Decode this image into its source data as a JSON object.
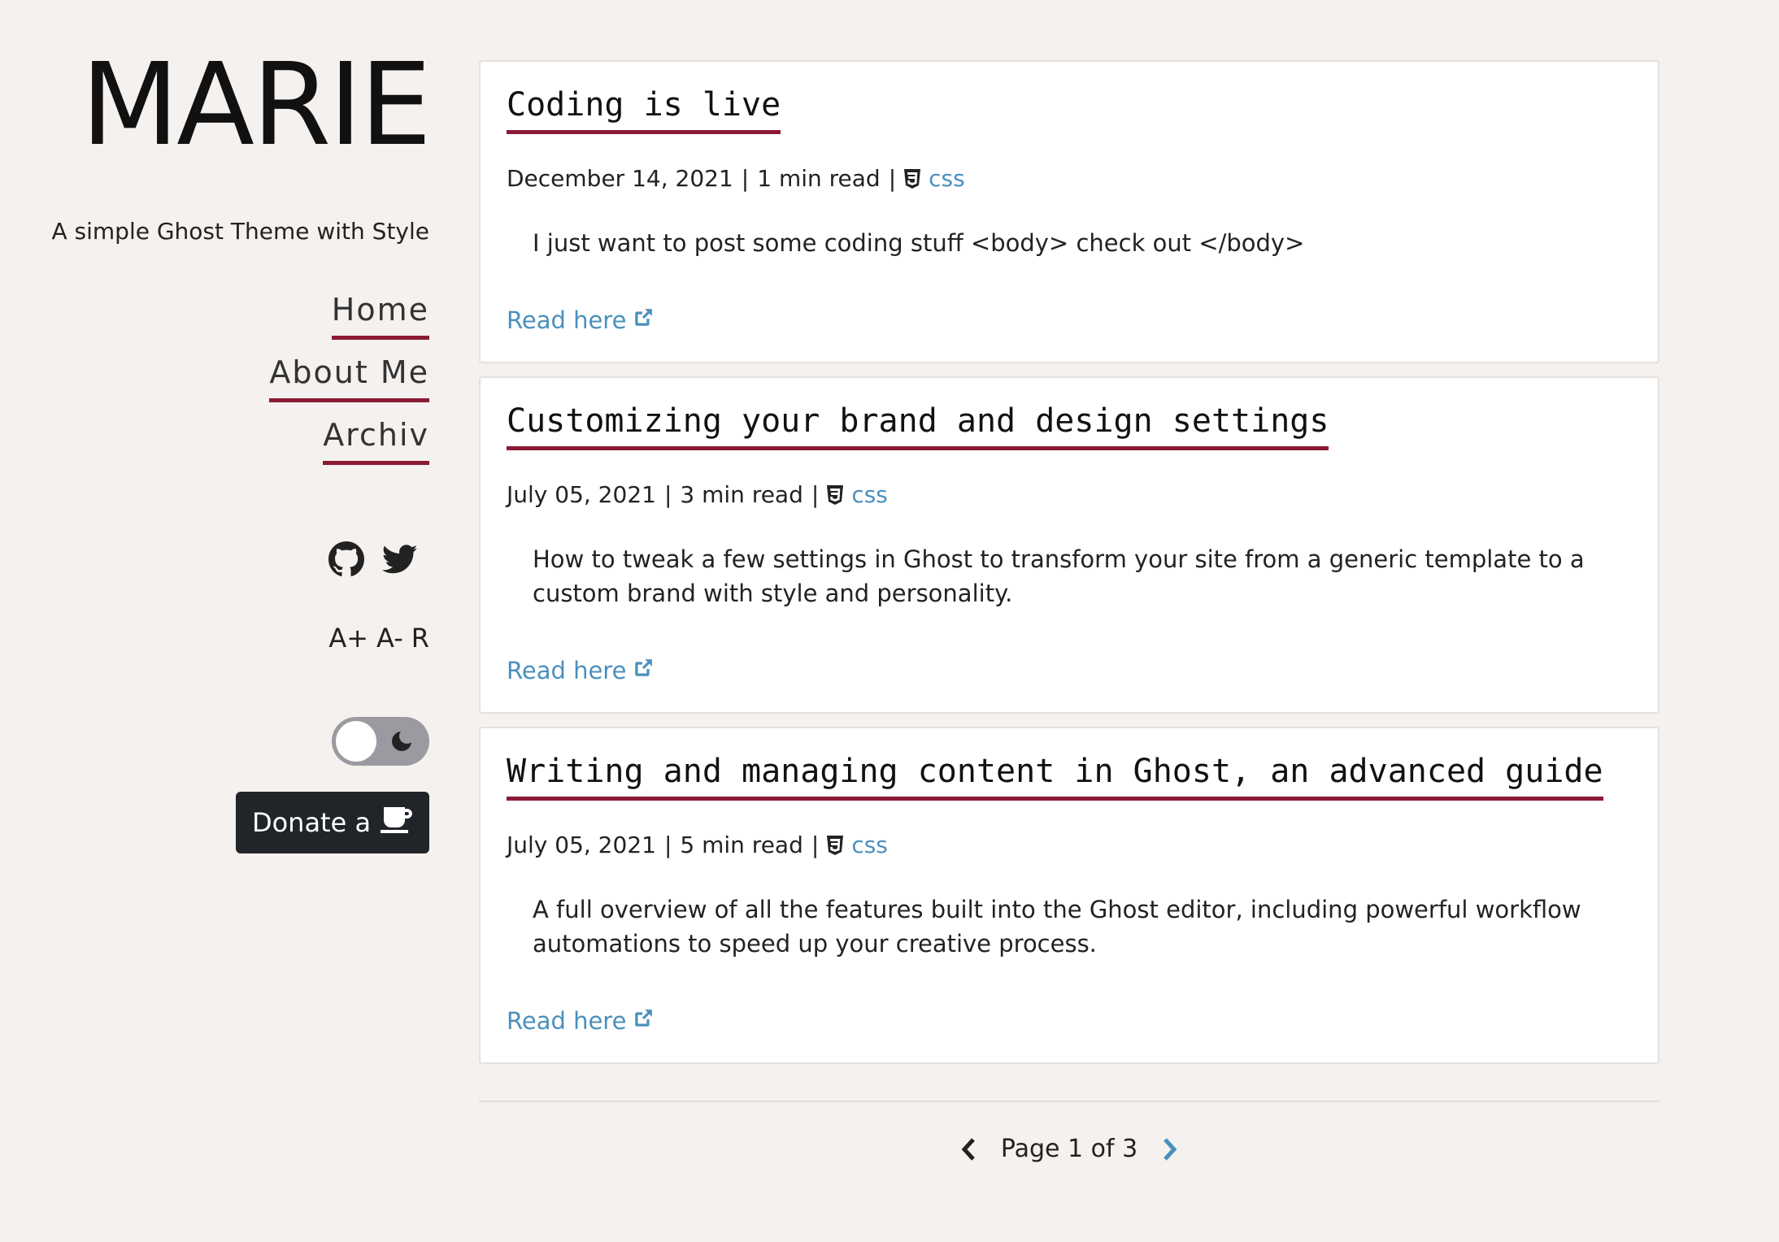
{
  "site": {
    "title": "MARIE",
    "tagline": "A simple Ghost Theme with Style"
  },
  "nav": {
    "items": [
      {
        "label": "Home"
      },
      {
        "label": "About Me"
      },
      {
        "label": "Archiv"
      }
    ]
  },
  "social": {
    "icons": [
      "github-icon",
      "twitter-icon"
    ]
  },
  "font_controls": {
    "increase": "A+",
    "decrease": "A-",
    "reset": "R"
  },
  "theme_toggle": {
    "state": "light",
    "icon": "moon-icon"
  },
  "donate": {
    "label": "Donate a",
    "icon": "coffee-cup-icon"
  },
  "posts": [
    {
      "title": "Coding is live",
      "date": "December 14, 2021",
      "read_time": "1 min read",
      "tag": "css",
      "excerpt": "I just want to post some coding stuff <body> check out </body>",
      "read_more": "Read here"
    },
    {
      "title": "Customizing your brand and design settings",
      "date": "July 05, 2021",
      "read_time": "3 min read",
      "tag": "css",
      "excerpt": "How to tweak a few settings in Ghost to transform your site from a generic template to a custom brand with style and personality.",
      "read_more": "Read here"
    },
    {
      "title": "Writing and managing content in Ghost, an advanced guide",
      "date": "July 05, 2021",
      "read_time": "5 min read",
      "tag": "css",
      "excerpt": "A full overview of all the features built into the Ghost editor, including powerful workflow automations to speed up your creative process.",
      "read_more": "Read here"
    }
  ],
  "pagination": {
    "label": "Page 1 of 3"
  },
  "colors": {
    "background": "#f4f1ee",
    "accent_underline": "#8b1a35",
    "link": "#4a90bd",
    "donate_bg": "#212529",
    "toggle_bg": "#9a9aa0"
  }
}
